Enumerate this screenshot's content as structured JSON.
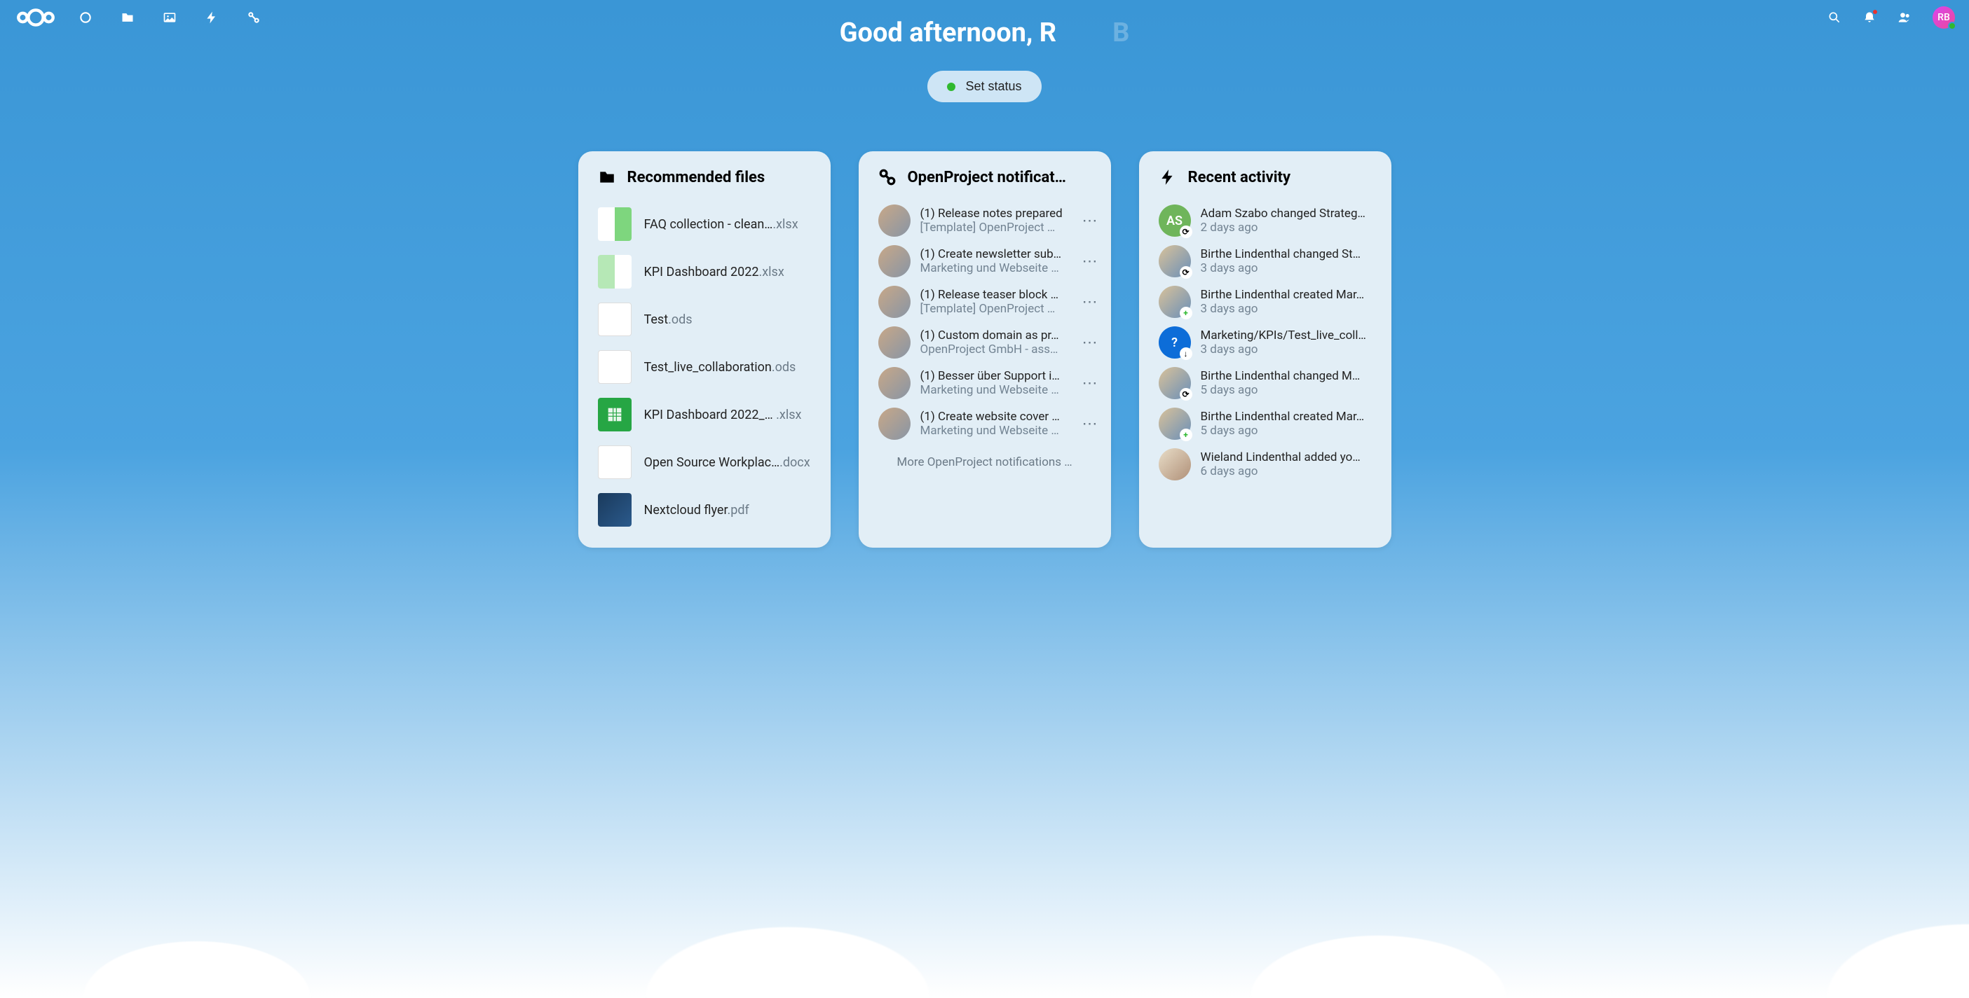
{
  "greeting": {
    "text": "Good afternoon, R",
    "faded_continuation": "B"
  },
  "status_button": {
    "label": "Set status"
  },
  "user": {
    "initials": "RB"
  },
  "widgets": {
    "recommended": {
      "title": "Recommended files",
      "files": [
        {
          "name": "FAQ collection - clean…",
          "ext": ".xlsx"
        },
        {
          "name": "KPI Dashboard 2022",
          "ext": ".xlsx"
        },
        {
          "name": "Test",
          "ext": ".ods"
        },
        {
          "name": "Test_live_collaboration",
          "ext": ".ods"
        },
        {
          "name": "KPI Dashboard 2022_…",
          "ext": ".xlsx"
        },
        {
          "name": "Open Source Workplac…",
          "ext": ".docx"
        },
        {
          "name": "Nextcloud flyer",
          "ext": ".pdf"
        }
      ]
    },
    "openproject": {
      "title": "OpenProject notificat…",
      "items": [
        {
          "title": "(1) Release notes prepared",
          "sub": "[Template] OpenProject …"
        },
        {
          "title": "(1) Create newsletter sub…",
          "sub": "Marketing und Webseite …"
        },
        {
          "title": "(1) Release teaser block …",
          "sub": "[Template] OpenProject …"
        },
        {
          "title": "(1) Custom domain as pr…",
          "sub": "OpenProject GmbH - ass…"
        },
        {
          "title": "(1) Besser über Support i…",
          "sub": "Marketing und Webseite …"
        },
        {
          "title": "(1) Create website cover …",
          "sub": "Marketing und Webseite …"
        }
      ],
      "more_link": "More OpenProject notifications …"
    },
    "activity": {
      "title": "Recent activity",
      "items": [
        {
          "avatar_label": "AS",
          "title": "Adam Szabo changed Strateg…",
          "time": "2 days ago",
          "badge": "sync"
        },
        {
          "avatar_label": "",
          "title": "Birthe Lindenthal changed St…",
          "time": "3 days ago",
          "badge": "sync"
        },
        {
          "avatar_label": "",
          "title": "Birthe Lindenthal created Mar…",
          "time": "3 days ago",
          "badge": "plus"
        },
        {
          "avatar_label": "?",
          "title": "Marketing/KPIs/Test_live_coll…",
          "time": "3 days ago",
          "badge": "down"
        },
        {
          "avatar_label": "",
          "title": "Birthe Lindenthal changed M…",
          "time": "5 days ago",
          "badge": "sync"
        },
        {
          "avatar_label": "",
          "title": "Birthe Lindenthal created Mar…",
          "time": "5 days ago",
          "badge": "plus"
        },
        {
          "avatar_label": "",
          "title": "Wieland Lindenthal added yo…",
          "time": "6 days ago",
          "badge": ""
        }
      ]
    }
  }
}
